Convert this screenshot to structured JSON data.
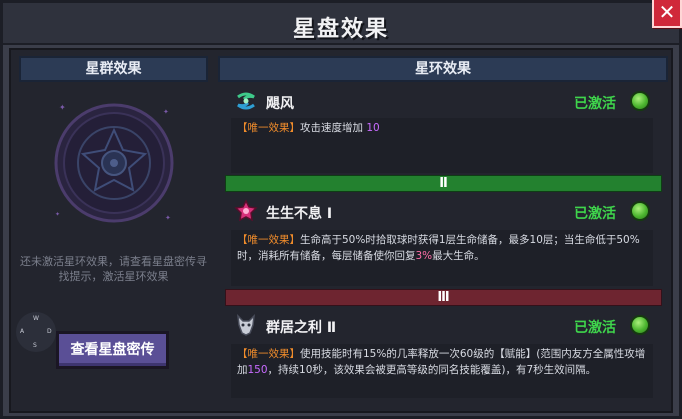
{
  "window": {
    "title": "星盘效果"
  },
  "left_panel": {
    "header": "星群效果",
    "hint": "还未激活星环效果，请查看星盘密传寻找提示，激活星环效果",
    "button": "查看星盘密传",
    "compass": {
      "n": "W",
      "e": "D",
      "s": "S",
      "w": "A"
    }
  },
  "right_panel": {
    "header": "星环效果",
    "effects": [
      {
        "name": "飓风",
        "status": "已激活",
        "tag": "【唯一效果】",
        "desc_pre": "攻击速度增加",
        "desc_hl": "10",
        "desc_post": ""
      },
      {
        "name": "生生不息 Ⅰ",
        "status": "已激活",
        "tag": "【唯一效果】",
        "desc_pre": "生命高于50%时拾取球时获得1层生命储备，最多10层；当生命低于50%时，消耗所有储备，每层储备使你回复",
        "desc_hl": "3%",
        "desc_post": "最大生命。"
      },
      {
        "name": "群居之利 Ⅱ",
        "status": "已激活",
        "tag": "【唯一效果】",
        "desc_pre": "使用技能时有15%的几率释放一次60级的【赋能】(范围内友方全属性攻增加",
        "desc_hl": "150",
        "desc_post": "，持续10秒，该效果会被更高等级的同名技能覆盖)，有7秒生效间隔。"
      }
    ],
    "tiers": [
      {
        "label": "Ⅱ",
        "color": "#23812f"
      },
      {
        "label": "Ⅲ",
        "color": "#6e2530"
      }
    ]
  },
  "colors": {
    "accent_active": "#3fd54c",
    "tag_orange": "#f08c2b",
    "highlight_purple": "#c86bff",
    "button_purple": "#5a4f96",
    "close_red": "#d0283a"
  }
}
